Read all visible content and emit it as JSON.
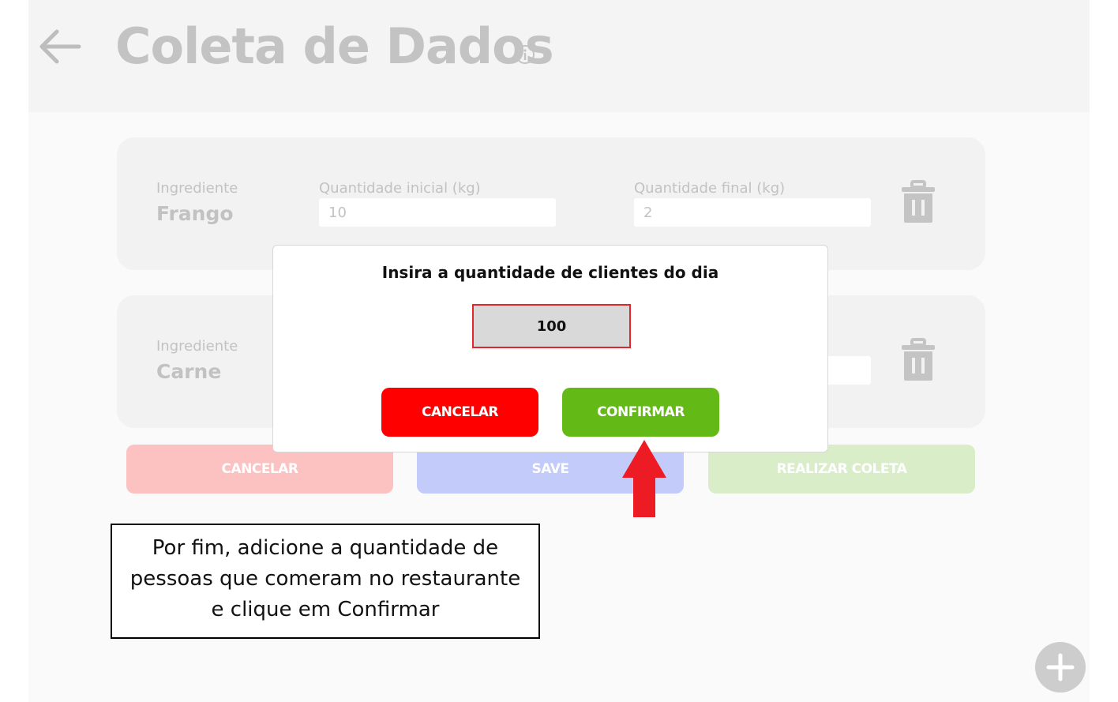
{
  "header": {
    "title": "Coleta de Dados"
  },
  "ingredients": [
    {
      "label": "Ingrediente",
      "name": "Frango",
      "initial_label": "Quantidade inicial (kg)",
      "initial_value": "10",
      "final_label": "Quantidade final (kg)",
      "final_value": "2"
    },
    {
      "label": "Ingrediente",
      "name": "Carne"
    }
  ],
  "actions": {
    "cancel_label": "CANCELAR",
    "save_label": "SAVE",
    "collect_label": "REALIZAR COLETA"
  },
  "modal": {
    "title": "Insira a quantidade de clientes do dia",
    "input_value": "100",
    "cancel_label": "CANCELAR",
    "confirm_label": "CONFIRMAR"
  },
  "callout": {
    "lines": [
      "Por fim, adicione  a quantidade de",
      "pessoas que comeram no restaurante",
      "e clique em Confirmar"
    ]
  },
  "colors": {
    "danger": "#ff0000",
    "success": "#63ba16",
    "highlight_border": "#e3262b",
    "arrow": "#ed1c24"
  },
  "icons": [
    "arrow-left-icon",
    "info-icon",
    "trash-icon",
    "plus-icon",
    "arrow-up-icon"
  ]
}
